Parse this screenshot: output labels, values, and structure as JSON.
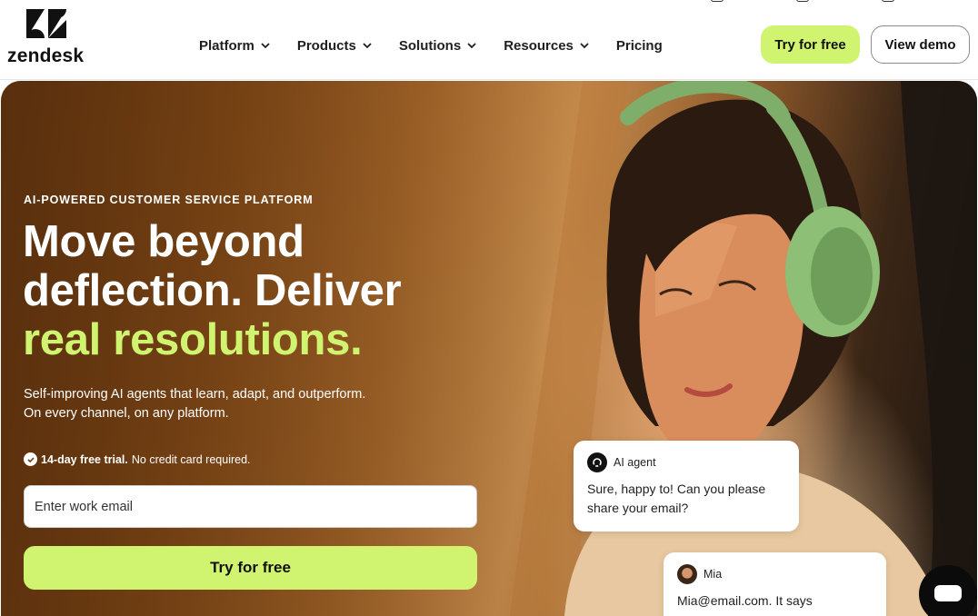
{
  "brand": {
    "name": "zendesk",
    "logo_icon": "zendesk-z-logo"
  },
  "nav": {
    "items": [
      {
        "label": "Platform",
        "has_dropdown": true
      },
      {
        "label": "Products",
        "has_dropdown": true
      },
      {
        "label": "Solutions",
        "has_dropdown": true
      },
      {
        "label": "Resources",
        "has_dropdown": true
      },
      {
        "label": "Pricing",
        "has_dropdown": false
      }
    ],
    "try_label": "Try for free",
    "demo_label": "View demo"
  },
  "hero": {
    "eyebrow": "AI-POWERED CUSTOMER SERVICE PLATFORM",
    "headline_line1": "Move beyond",
    "headline_line2": "deflection. Deliver",
    "headline_accent": "real resolutions.",
    "subtext_line1": "Self-improving AI agents that learn, adapt, and outperform.",
    "subtext_line2": "On every channel, on any platform.",
    "trial_bold": "14-day free trial.",
    "trial_rest": "No credit card required.",
    "email_placeholder": "Enter work email",
    "cta_label": "Try for free"
  },
  "chat": {
    "ai": {
      "name": "AI agent",
      "message": "Sure, happy to! Can you please share your email?"
    },
    "user": {
      "name": "Mia",
      "message": "Mia@email.com. It says"
    }
  },
  "colors": {
    "accent": "#d1f470",
    "dark": "#0b0b0b",
    "text": "#1f1f1f"
  },
  "icons": {
    "chat_fab": "chat-bubble-icon",
    "check": "check-circle-icon",
    "chevron": "chevron-down-icon"
  }
}
